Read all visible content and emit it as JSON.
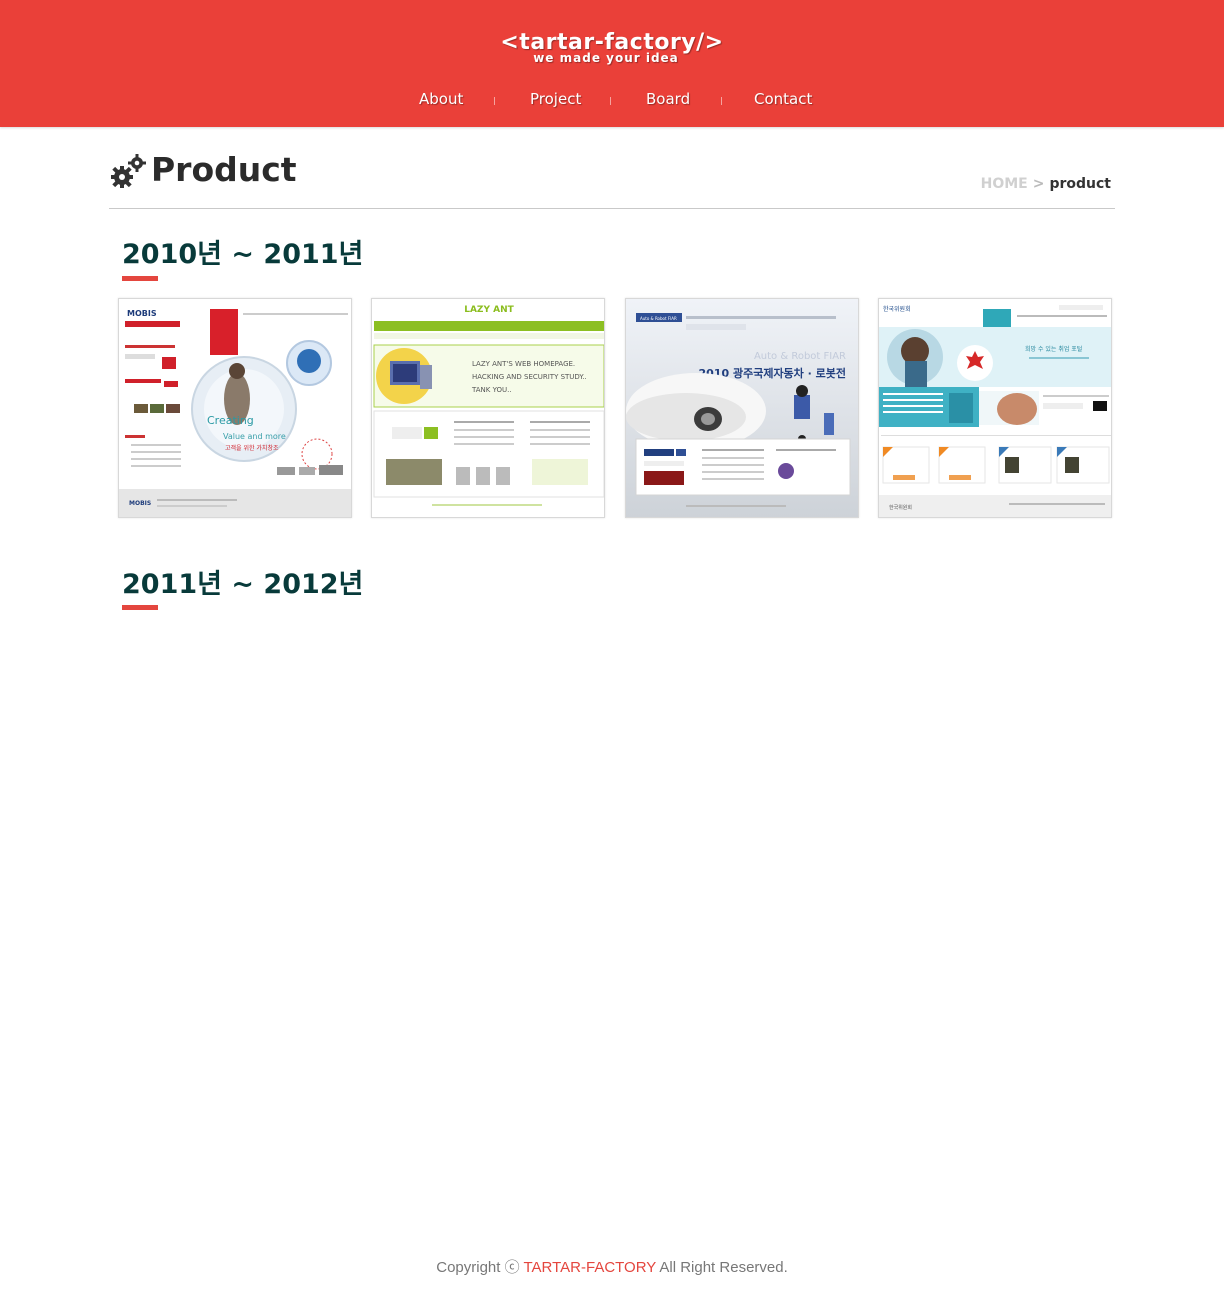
{
  "header": {
    "logo_text": "<tartar-factory/>",
    "tagline": "we made your idea",
    "nav": [
      {
        "label": "About"
      },
      {
        "label": "Project"
      },
      {
        "label": "Board"
      },
      {
        "label": "Contact"
      }
    ]
  },
  "page": {
    "title": "Product",
    "breadcrumb": {
      "home": "HOME",
      "separator": ">",
      "current": "product"
    }
  },
  "sections": [
    {
      "title": "2010년 ~ 2011년",
      "thumbnails": [
        {
          "name": "MOBIS",
          "caption_main": "Creating",
          "caption_sub": "Value and more",
          "caption_kr": "고객을 위한 가치창조"
        },
        {
          "name": "LAZY ANT",
          "lines": [
            "LAZY ANT'S WEB HOMEPAGE.",
            "HACKING AND SECURITY STUDY..",
            "TANK YOU.."
          ]
        },
        {
          "name": "Auto & Robot FIAR",
          "headline": "2010 광주국제자동차 · 로봇전"
        },
        {
          "name": "한국위원회",
          "headline": "희망 수 있는 취업 포털"
        }
      ]
    },
    {
      "title": "2011년 ~ 2012년",
      "thumbnails": []
    }
  ],
  "footer": {
    "prefix": "Copyright ⓒ ",
    "brand": "TARTAR-FACTORY",
    "suffix": " All Right Reserved."
  },
  "colors": {
    "header_bg": "#ea4039",
    "accent": "#e4463e",
    "section_title": "#083a3a"
  }
}
